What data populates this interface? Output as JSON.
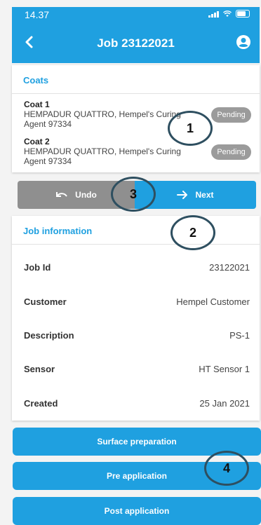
{
  "status_bar": {
    "time": "14.37"
  },
  "header": {
    "title": "Job 23122021"
  },
  "coats": {
    "title": "Coats",
    "items": [
      {
        "name": "Coat 1",
        "description": "HEMPADUR QUATTRO, Hempel's Curing Agent 97334",
        "status": "Pending"
      },
      {
        "name": "Coat 2",
        "description": "HEMPADUR QUATTRO, Hempel's Curing Agent 97334",
        "status": "Pending"
      }
    ]
  },
  "nav": {
    "undo_label": "Undo",
    "next_label": "Next"
  },
  "job_info": {
    "title": "Job information",
    "rows": [
      {
        "label": "Job Id",
        "value": "23122021"
      },
      {
        "label": "Customer",
        "value": "Hempel Customer"
      },
      {
        "label": "Description",
        "value": "PS-1"
      },
      {
        "label": "Sensor",
        "value": "HT Sensor 1"
      },
      {
        "label": "Created",
        "value": "25 Jan 2021"
      }
    ]
  },
  "actions": [
    "Surface preparation",
    "Pre application",
    "Post application"
  ],
  "callouts": [
    "1",
    "2",
    "3",
    "4"
  ],
  "colors": {
    "primary": "#1fa0e0",
    "pending": "#9b9b9b",
    "undo": "#8f8f8f",
    "callout_ring": "#2e4f60"
  }
}
